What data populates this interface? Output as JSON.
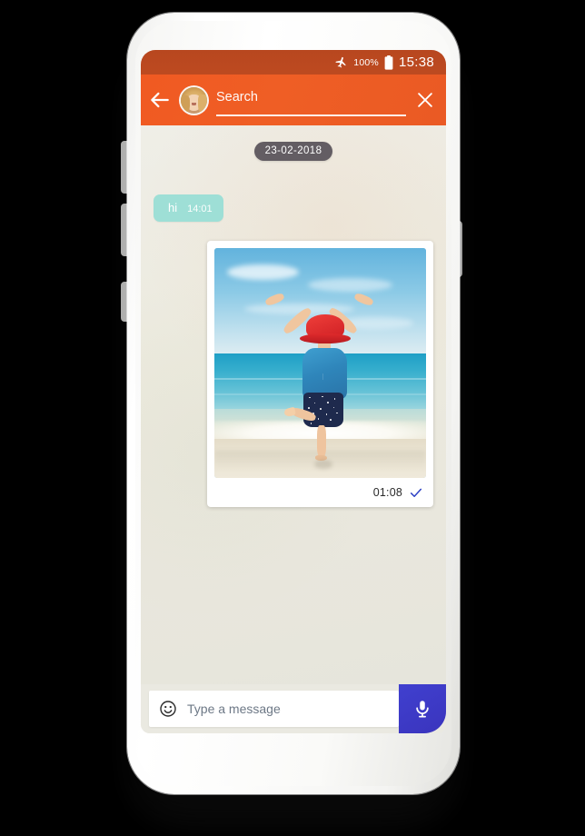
{
  "statusbar": {
    "airplane_icon": "airplane-mode-icon",
    "battery_percent": "100%",
    "battery_icon": "battery-full-icon",
    "time": "15:38"
  },
  "appbar": {
    "back_icon": "back-arrow-icon",
    "avatar_label": "contact-avatar",
    "search_value": "",
    "search_placeholder": "Search",
    "close_icon": "close-icon",
    "accent_color": "#f05a22",
    "statusbar_color": "#b8471f"
  },
  "chat": {
    "date_separator": "23-02-2018",
    "incoming_message": {
      "text": "hi",
      "time": "14:01",
      "bubble_color": "#9edfd6"
    },
    "photo_message": {
      "description": "child in red hat with arms raised on beach",
      "time": "01:08",
      "status_icon": "single-check-icon",
      "check_color": "#2b3fc4"
    },
    "background_color": "#eae9e1"
  },
  "composer": {
    "emoji_icon": "emoji-smiley-icon",
    "input_value": "",
    "input_placeholder": "Type a message",
    "mic_icon": "microphone-icon",
    "mic_button_color": "#4040cf"
  }
}
